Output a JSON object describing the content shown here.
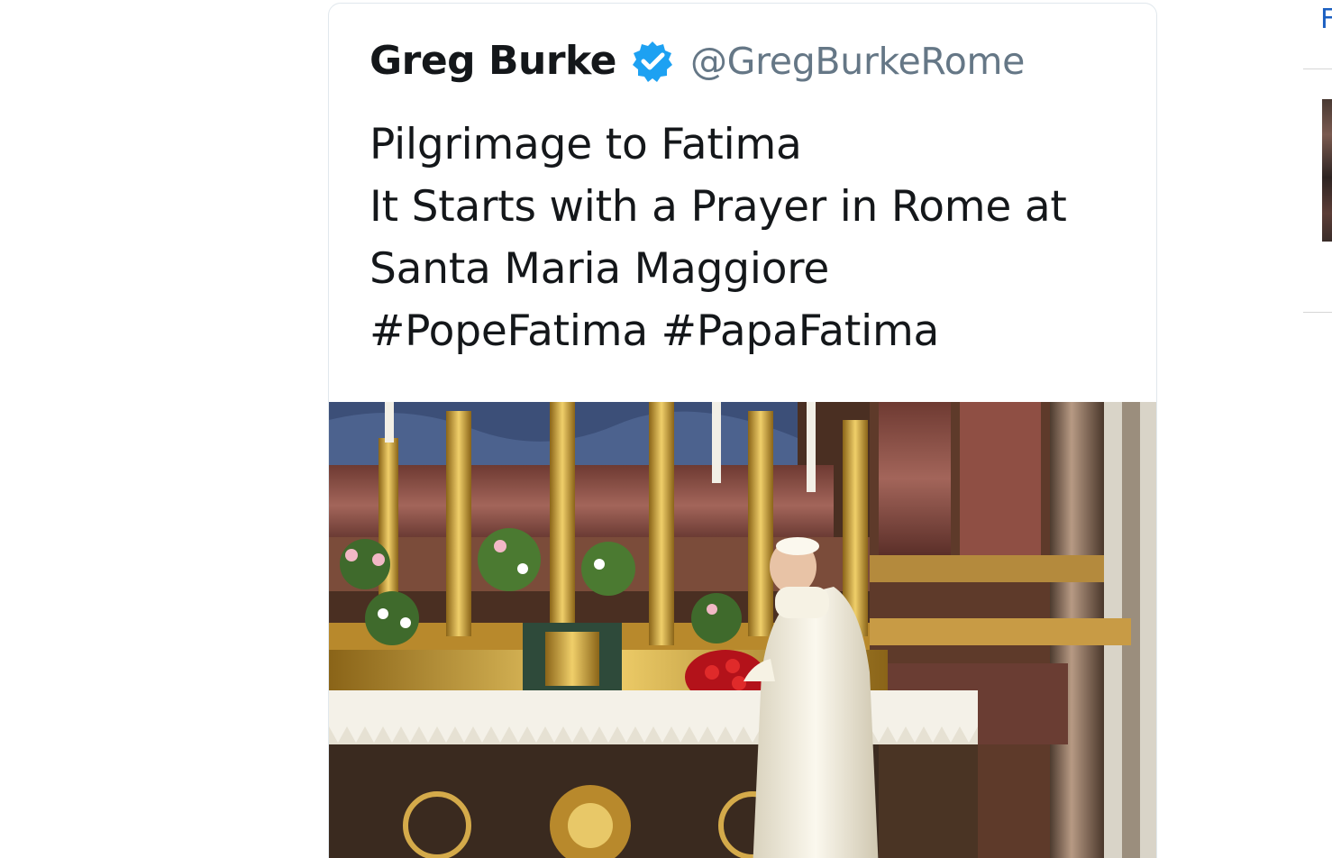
{
  "tweet": {
    "author": {
      "name": "Greg Burke",
      "handle": "@GregBurkeRome",
      "verified_icon": "verified-badge-icon"
    },
    "text_lines": [
      "Pilgrimage to Fatima",
      "It Starts with a Prayer in Rome at",
      "Santa Maria Maggiore",
      "#PopeFatima #PapaFatima"
    ],
    "photo": {
      "subject": "photo-pope-praying-at-altar"
    }
  },
  "sidebar": {
    "edge_text": "F",
    "thumbnail": "sidebar-thumbnail-image"
  },
  "colors": {
    "name": "#14171a",
    "handle": "#657786",
    "verified": "#1da1f2",
    "border": "#e1e8ed",
    "link": "#1b5fc1"
  }
}
